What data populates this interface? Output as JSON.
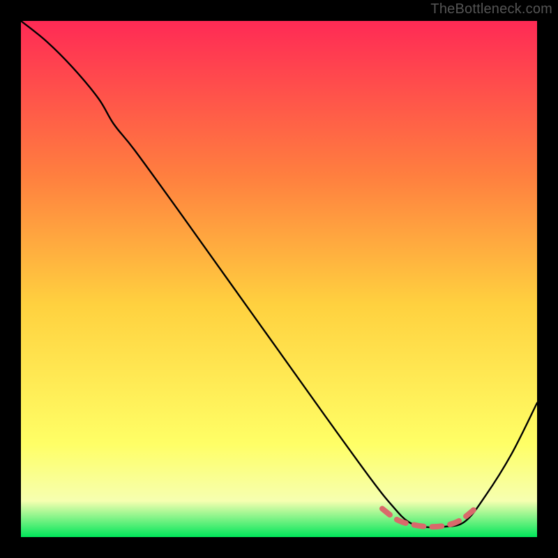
{
  "watermark": "TheBottleneck.com",
  "chart_data": {
    "type": "line",
    "title": "",
    "xlabel": "",
    "ylabel": "",
    "xlim": [
      0,
      100
    ],
    "ylim": [
      0,
      100
    ],
    "grid": false,
    "legend": false,
    "background_gradient": {
      "top": "#ff2a55",
      "mid_upper": "#ff7f3f",
      "mid": "#ffd13f",
      "mid_lower": "#ffff66",
      "band": "#f6ffb0",
      "bottom": "#00e65a"
    },
    "series": [
      {
        "name": "bottleneck-curve",
        "color": "#000000",
        "x": [
          0,
          5,
          10,
          15,
          18,
          22,
          30,
          40,
          50,
          60,
          68,
          72,
          75,
          78,
          82,
          86,
          90,
          95,
          100
        ],
        "y": [
          100,
          96,
          91,
          85,
          80,
          75,
          64,
          50,
          36,
          22,
          11,
          6,
          3,
          2,
          2,
          3,
          8,
          16,
          26
        ]
      }
    ],
    "highlight_segment": {
      "name": "flat-bottom",
      "color": "#d9696b",
      "style": "dashed",
      "x": [
        70,
        73,
        76,
        79,
        82,
        85,
        88
      ],
      "y": [
        5.5,
        3.3,
        2.4,
        2.0,
        2.2,
        3.2,
        5.5
      ]
    }
  }
}
